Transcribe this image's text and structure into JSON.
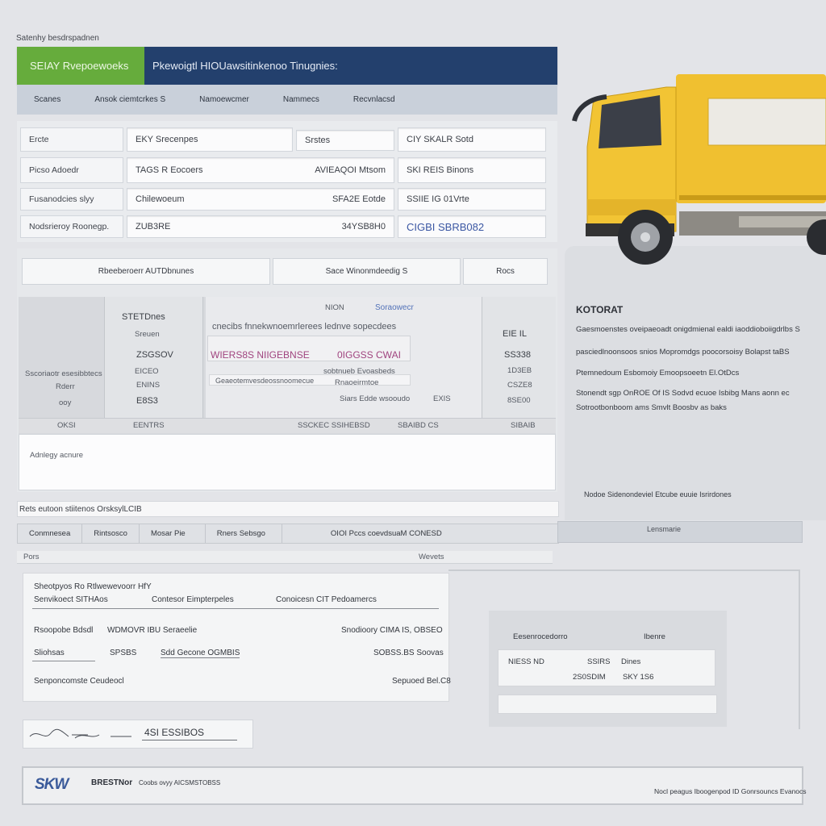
{
  "header": {
    "caption": "Satenhy besdrspadnen",
    "app_title": "SEIAY Rvepoewoeks",
    "doc_title": "Pkewoigtl HIOUawsitinkenoo Tinugnies:"
  },
  "tabs": [
    "Scanes",
    "Ansok ciemtcrkes S",
    "Namoewcmer",
    "Nammecs",
    "Recvnlacsd"
  ],
  "form": {
    "rows": [
      {
        "label": "Ercte",
        "col1": "EKY Srecenpes",
        "col2": "Srstes",
        "col3": "CIY SKALR Sotd"
      },
      {
        "label": "Picso Adoedr",
        "col1": "TAGS R Eocoers",
        "col2": "AVIEAQOI Mtsom",
        "col3": "SKI REIS Binons"
      },
      {
        "label": "Fusanodcies slyy",
        "col1": "Chilewoeum",
        "col2": "SFA2E Eotde",
        "col3": "SSIIE IG 01Vrte"
      },
      {
        "label": "Nodsrieroy Roonegp.",
        "col1": "ZUB3RE",
        "col2": "34YSB8H0",
        "col3": "CIGBI SBRB082"
      }
    ]
  },
  "mid": {
    "header": [
      "Rbeeberoerr AUTDbnunes",
      "Sace Winonmdeedig S",
      "Rocs"
    ],
    "col_a": [
      "STETDnes",
      "Sreuen",
      "ZSGSOV",
      "EICEO",
      "ENINS",
      "E8S3"
    ],
    "col_a_label": [
      "Sscoriaotr esesibbtecs",
      "Rderr",
      "ooy"
    ],
    "center_top": "NION",
    "center_link": "Soraowecr",
    "center_desc": "cnecibs fnnekwnoemrlerees lednve sopecdees",
    "center_pink": "WIERS8S NIIGEBNSE",
    "center_num": "0IGGSS CWAI",
    "center_sub": "sobtnueb Evoasbeds",
    "center_line2": "Geaeotemvesdeossnoomecue",
    "center_line3": "Rnaoeirmtoe",
    "center_line4": "Siars Edde wsooudo",
    "center_line5": "EXIS",
    "col_c": [
      "EIE IL",
      "SS338",
      "1D3EB",
      "CSZE8",
      "8SE00"
    ],
    "total": [
      "OKSI",
      "EENTRS",
      "SSCKEC SSIHEBSD",
      "SBAIBD  CS",
      "SIBAIB"
    ],
    "notes": "Adnlegy acnure"
  },
  "strips": {
    "strip1": "Rets eutoon stiitenos OrsksylLCIB",
    "strip2": [
      "Conmnesea",
      "Rintsosco",
      "Mosar Pie",
      "Rners Sebsgo",
      "OIOI Pccs coevdsuaM CONESD"
    ],
    "strip2b": "Lensmarie",
    "strip3_left": "Pors",
    "strip3_right": "Wevets"
  },
  "summary": {
    "line1": "Sheotpyos Ro Rtlwewevoorr HfY",
    "line2": "Senvikoect SITHAos",
    "line2b": "Contesor Eimpterpeles",
    "line2c": "Conoicesn CIT Pedoamercs",
    "row2_label": "Rsoopobe Bdsdl",
    "row2_val": "WDMOVR IBU Seraeelie",
    "row2_right": "Snodioory CIMA IS, OBSEO",
    "row3_label": "Sliohsas",
    "row3_mid": "SPSBS",
    "row3_val": "Sdd Gecone OGMBIS",
    "row3_right": "SOBSS.BS Soovas",
    "row4_label": "Senponcomste Ceudeocl",
    "row4_right": "Sepuoed Bel.C8"
  },
  "mini": {
    "head_left": "Eesenrocedorro",
    "head_right": "Ibenre",
    "r1_left": "NIESS ND",
    "r1_mid": "SSIRS",
    "r1_right": "Dines",
    "r2_mid": "2S0SDIM",
    "r2_right": "SKY 1S6"
  },
  "signature": {
    "amount": "4SI ESSIBOS"
  },
  "footer": {
    "logo": "SKW",
    "brand": "BRESTNor",
    "brand_sub": "Coobs ovyy AICSMSTOBSS",
    "right": "Nocl peagus Iboogenpod ID Gonrsouncs Evanocs"
  },
  "side": {
    "heading": "KOTORAT",
    "lines": [
      "Gaesmoenstes oveipaeoadt onigdmienal ealdi iaoddioboiigdrlbs S",
      "pasciedlnoonsoos snios Mopromdgs poocorsoisy Bolapst taBS",
      "Ptemnedoum Esbomoiy Emoopsoeetn El.OtDcs",
      "Stonendt sgp OnROE Of IS Sodvd ecuoe Isbibg Mans aonn ec",
      "Sotrootbonboom ams Smvlt Boosbv as baks"
    ],
    "footnote": "Nodoe Sidenondeviel Etcube euuie Isrirdones"
  },
  "colors": {
    "accent_green": "#66ac3c",
    "header_navy": "#23406d",
    "truck_yellow": "#f0c030"
  }
}
